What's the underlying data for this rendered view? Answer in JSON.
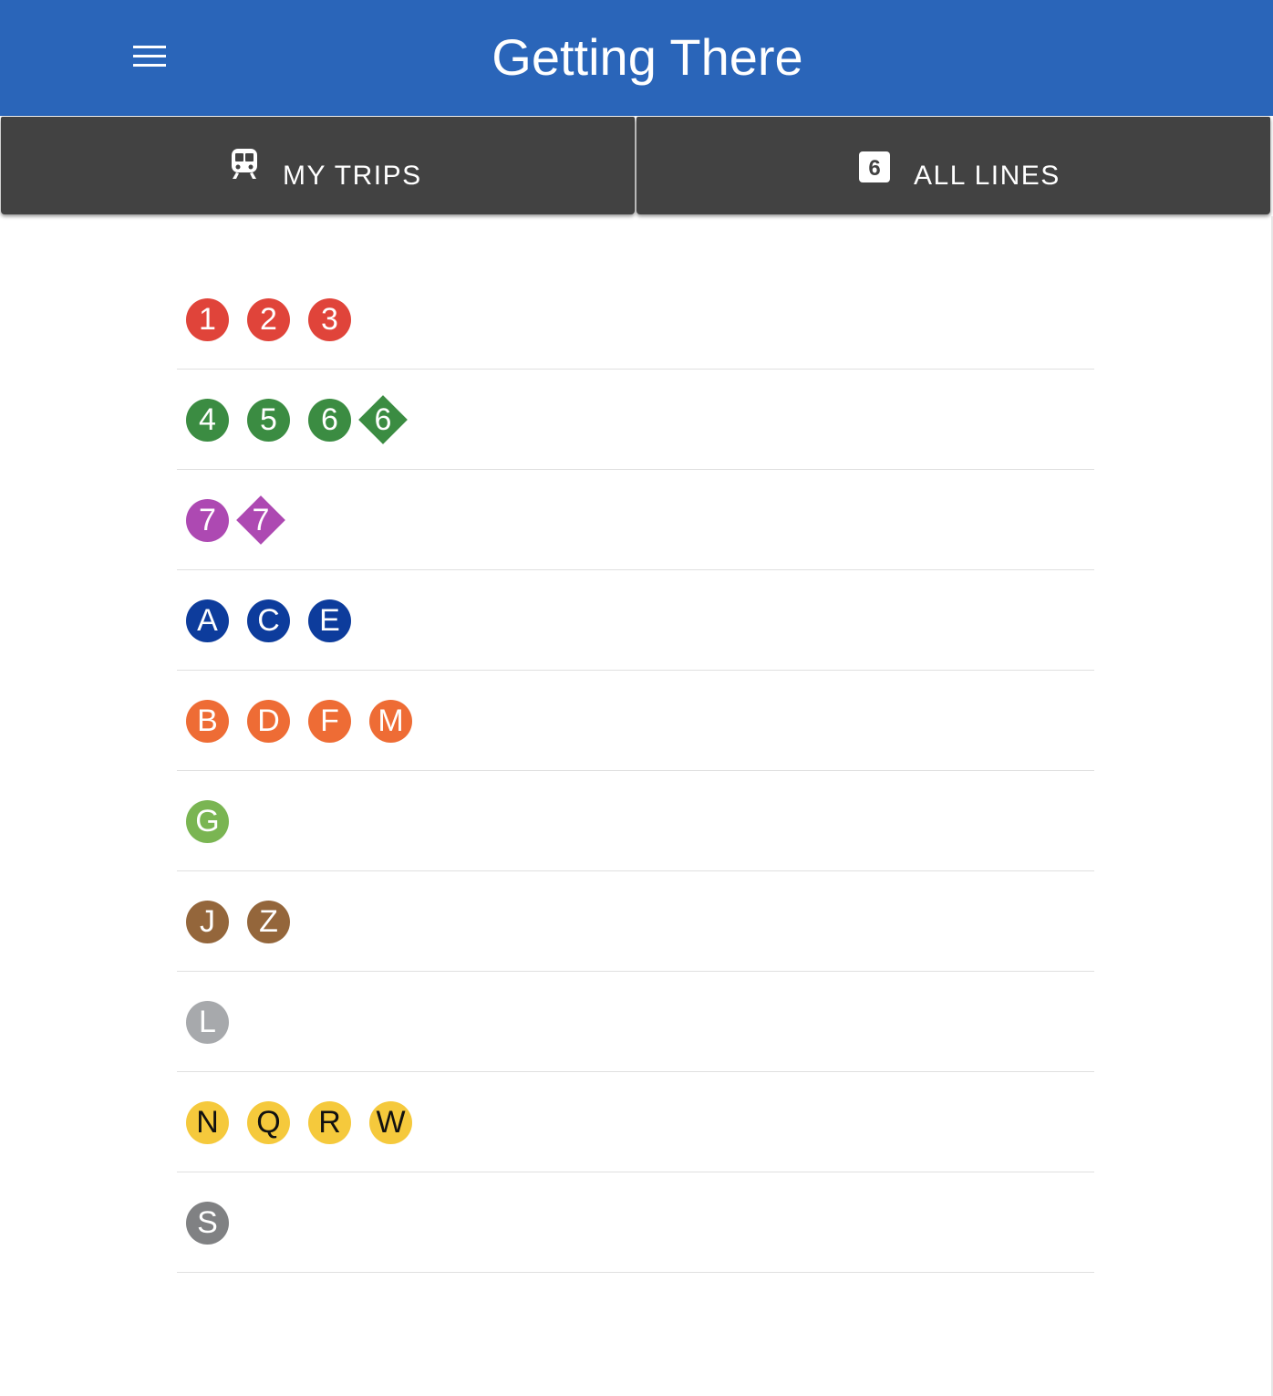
{
  "app_bar": {
    "title": "Getting There",
    "menu_icon": "hamburger-menu-icon",
    "background": "#2a65b9"
  },
  "tabs": [
    {
      "label": "MY TRIPS",
      "icon": "train-icon"
    },
    {
      "label": "ALL LINES",
      "icon": "route-6-badge-icon",
      "icon_text": "6"
    }
  ],
  "line_groups": [
    {
      "bullets": [
        {
          "text": "1",
          "shape": "circle",
          "color": "#e0443a",
          "text_color": "#ffffff"
        },
        {
          "text": "2",
          "shape": "circle",
          "color": "#e0443a",
          "text_color": "#ffffff"
        },
        {
          "text": "3",
          "shape": "circle",
          "color": "#e0443a",
          "text_color": "#ffffff"
        }
      ]
    },
    {
      "bullets": [
        {
          "text": "4",
          "shape": "circle",
          "color": "#3b8c42",
          "text_color": "#ffffff"
        },
        {
          "text": "5",
          "shape": "circle",
          "color": "#3b8c42",
          "text_color": "#ffffff"
        },
        {
          "text": "6",
          "shape": "circle",
          "color": "#3b8c42",
          "text_color": "#ffffff"
        },
        {
          "text": "6",
          "shape": "diamond",
          "color": "#3b8c42",
          "text_color": "#ffffff"
        }
      ]
    },
    {
      "bullets": [
        {
          "text": "7",
          "shape": "circle",
          "color": "#ad49b2",
          "text_color": "#ffffff"
        },
        {
          "text": "7",
          "shape": "diamond",
          "color": "#ad49b2",
          "text_color": "#ffffff"
        }
      ]
    },
    {
      "bullets": [
        {
          "text": "A",
          "shape": "circle",
          "color": "#0d3c9c",
          "text_color": "#ffffff"
        },
        {
          "text": "C",
          "shape": "circle",
          "color": "#0d3c9c",
          "text_color": "#ffffff"
        },
        {
          "text": "E",
          "shape": "circle",
          "color": "#0d3c9c",
          "text_color": "#ffffff"
        }
      ]
    },
    {
      "bullets": [
        {
          "text": "B",
          "shape": "circle",
          "color": "#ee6c35",
          "text_color": "#ffffff"
        },
        {
          "text": "D",
          "shape": "circle",
          "color": "#ee6c35",
          "text_color": "#ffffff"
        },
        {
          "text": "F",
          "shape": "circle",
          "color": "#ee6c35",
          "text_color": "#ffffff"
        },
        {
          "text": "M",
          "shape": "circle",
          "color": "#ee6c35",
          "text_color": "#ffffff"
        }
      ]
    },
    {
      "bullets": [
        {
          "text": "G",
          "shape": "circle",
          "color": "#7ab552",
          "text_color": "#ffffff"
        }
      ]
    },
    {
      "bullets": [
        {
          "text": "J",
          "shape": "circle",
          "color": "#94663b",
          "text_color": "#ffffff"
        },
        {
          "text": "Z",
          "shape": "circle",
          "color": "#94663b",
          "text_color": "#ffffff"
        }
      ]
    },
    {
      "bullets": [
        {
          "text": "L",
          "shape": "circle",
          "color": "#a7a9ac",
          "text_color": "#ffffff"
        }
      ]
    },
    {
      "bullets": [
        {
          "text": "N",
          "shape": "circle",
          "color": "#f5c93c",
          "text_color": "#111111"
        },
        {
          "text": "Q",
          "shape": "circle",
          "color": "#f5c93c",
          "text_color": "#111111"
        },
        {
          "text": "R",
          "shape": "circle",
          "color": "#f5c93c",
          "text_color": "#111111"
        },
        {
          "text": "W",
          "shape": "circle",
          "color": "#f5c93c",
          "text_color": "#111111"
        }
      ]
    },
    {
      "bullets": [
        {
          "text": "S",
          "shape": "circle",
          "color": "#808183",
          "text_color": "#ffffff"
        }
      ]
    }
  ]
}
